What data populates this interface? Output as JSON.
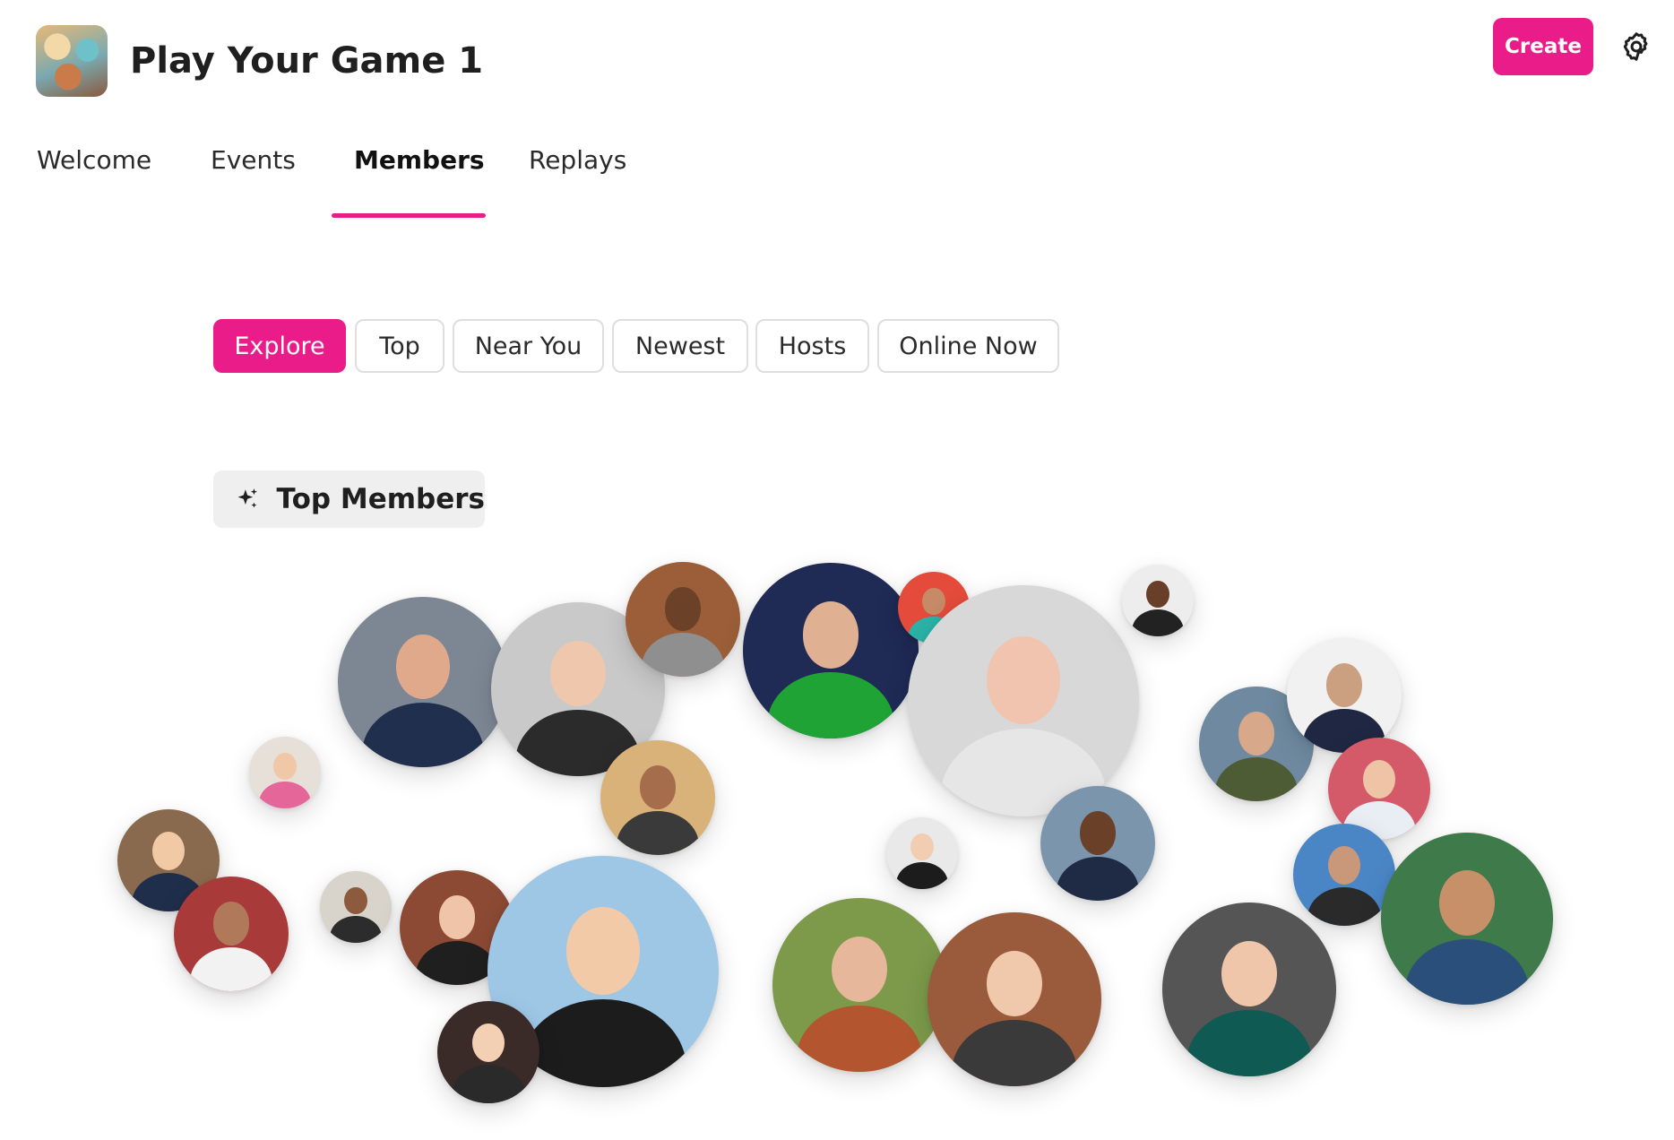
{
  "header": {
    "title": "Play Your Game 1",
    "create_label": "Create"
  },
  "tabs": [
    {
      "label": "Welcome",
      "active": false
    },
    {
      "label": "Events",
      "active": false
    },
    {
      "label": "Members",
      "active": true
    },
    {
      "label": "Replays",
      "active": false
    }
  ],
  "filters": [
    {
      "label": "Explore",
      "active": true
    },
    {
      "label": "Top",
      "active": false
    },
    {
      "label": "Near You",
      "active": false
    },
    {
      "label": "Newest",
      "active": false
    },
    {
      "label": "Hosts",
      "active": false
    },
    {
      "label": "Online Now",
      "active": false
    }
  ],
  "section": {
    "label": "Top Members",
    "icon": "sparkle-icon"
  },
  "colors": {
    "accent": "#ea1c8a",
    "chip_border": "#dedede",
    "pill_bg": "#efefef"
  }
}
